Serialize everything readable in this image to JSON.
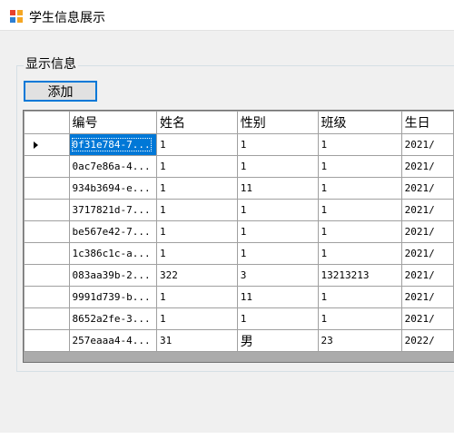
{
  "window": {
    "title": "学生信息展示"
  },
  "group": {
    "label": "显示信息"
  },
  "toolbar": {
    "add_label": "添加"
  },
  "grid": {
    "columns": [
      "编号",
      "姓名",
      "性别",
      "班级",
      "生日"
    ],
    "rows": [
      [
        "0f31e784-7...",
        "1",
        "1",
        "1",
        "2021/"
      ],
      [
        "0ac7e86a-4...",
        "1",
        "1",
        "1",
        "2021/"
      ],
      [
        "934b3694-e...",
        "1",
        "11",
        "1",
        "2021/"
      ],
      [
        "3717821d-7...",
        "1",
        "1",
        "1",
        "2021/"
      ],
      [
        "be567e42-7...",
        "1",
        "1",
        "1",
        "2021/"
      ],
      [
        "1c386c1c-a...",
        "1",
        "1",
        "1",
        "2021/"
      ],
      [
        "083aa39b-2...",
        "322",
        "3",
        "13213213",
        "2021/"
      ],
      [
        "9991d739-b...",
        "1",
        "11",
        "1",
        "2021/"
      ],
      [
        "8652a2fe-3...",
        "1",
        "1",
        "1",
        "2021/"
      ],
      [
        "257eaaa4-4...",
        "31",
        "男",
        "23",
        "2022/"
      ]
    ],
    "selected_row": 0
  },
  "colors": {
    "accent": "#0078d7",
    "client_bg": "#f0f0f0",
    "grid_bg": "#ababab"
  },
  "icons": {
    "app": "app-window-icon",
    "row_pointer": "current-row-arrow-icon"
  }
}
